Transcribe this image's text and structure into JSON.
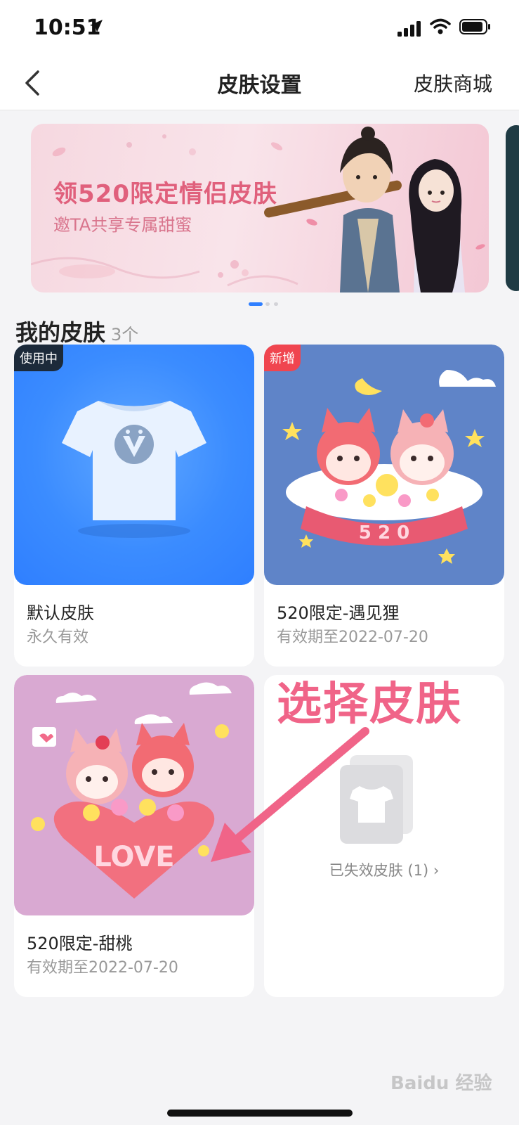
{
  "status_bar": {
    "time": "10:51"
  },
  "nav": {
    "title": "皮肤设置",
    "right_label": "皮肤商城"
  },
  "banner": {
    "title": "领520限定情侣皮肤",
    "subtitle": "邀TA共享专属甜蜜",
    "page_count": 3,
    "active_page": 1
  },
  "section": {
    "title": "我的皮肤",
    "count": "3个"
  },
  "skins": [
    {
      "name": "默认皮肤",
      "validity": "永久有效",
      "tag": "使用中",
      "tag_color": "#1c2a3a"
    },
    {
      "name": "520限定-遇见狸",
      "validity": "有效期至2022-07-20",
      "tag": "新增",
      "tag_color": "#f0454f"
    },
    {
      "name": "520限定-甜桃",
      "validity": "有效期至2022-07-20"
    }
  ],
  "expired": {
    "label": "已失效皮肤 (1) ›"
  },
  "annotation": {
    "text": "选择皮肤",
    "color": "#f06488"
  },
  "watermark": {
    "text": "Baidu 经验"
  },
  "colors": {
    "accent_blue": "#2f7fff",
    "card_blue_bg": "#3b8cff",
    "card_purple_bg": "#5f84c8",
    "card_pink_bg": "#d9a9d2"
  }
}
